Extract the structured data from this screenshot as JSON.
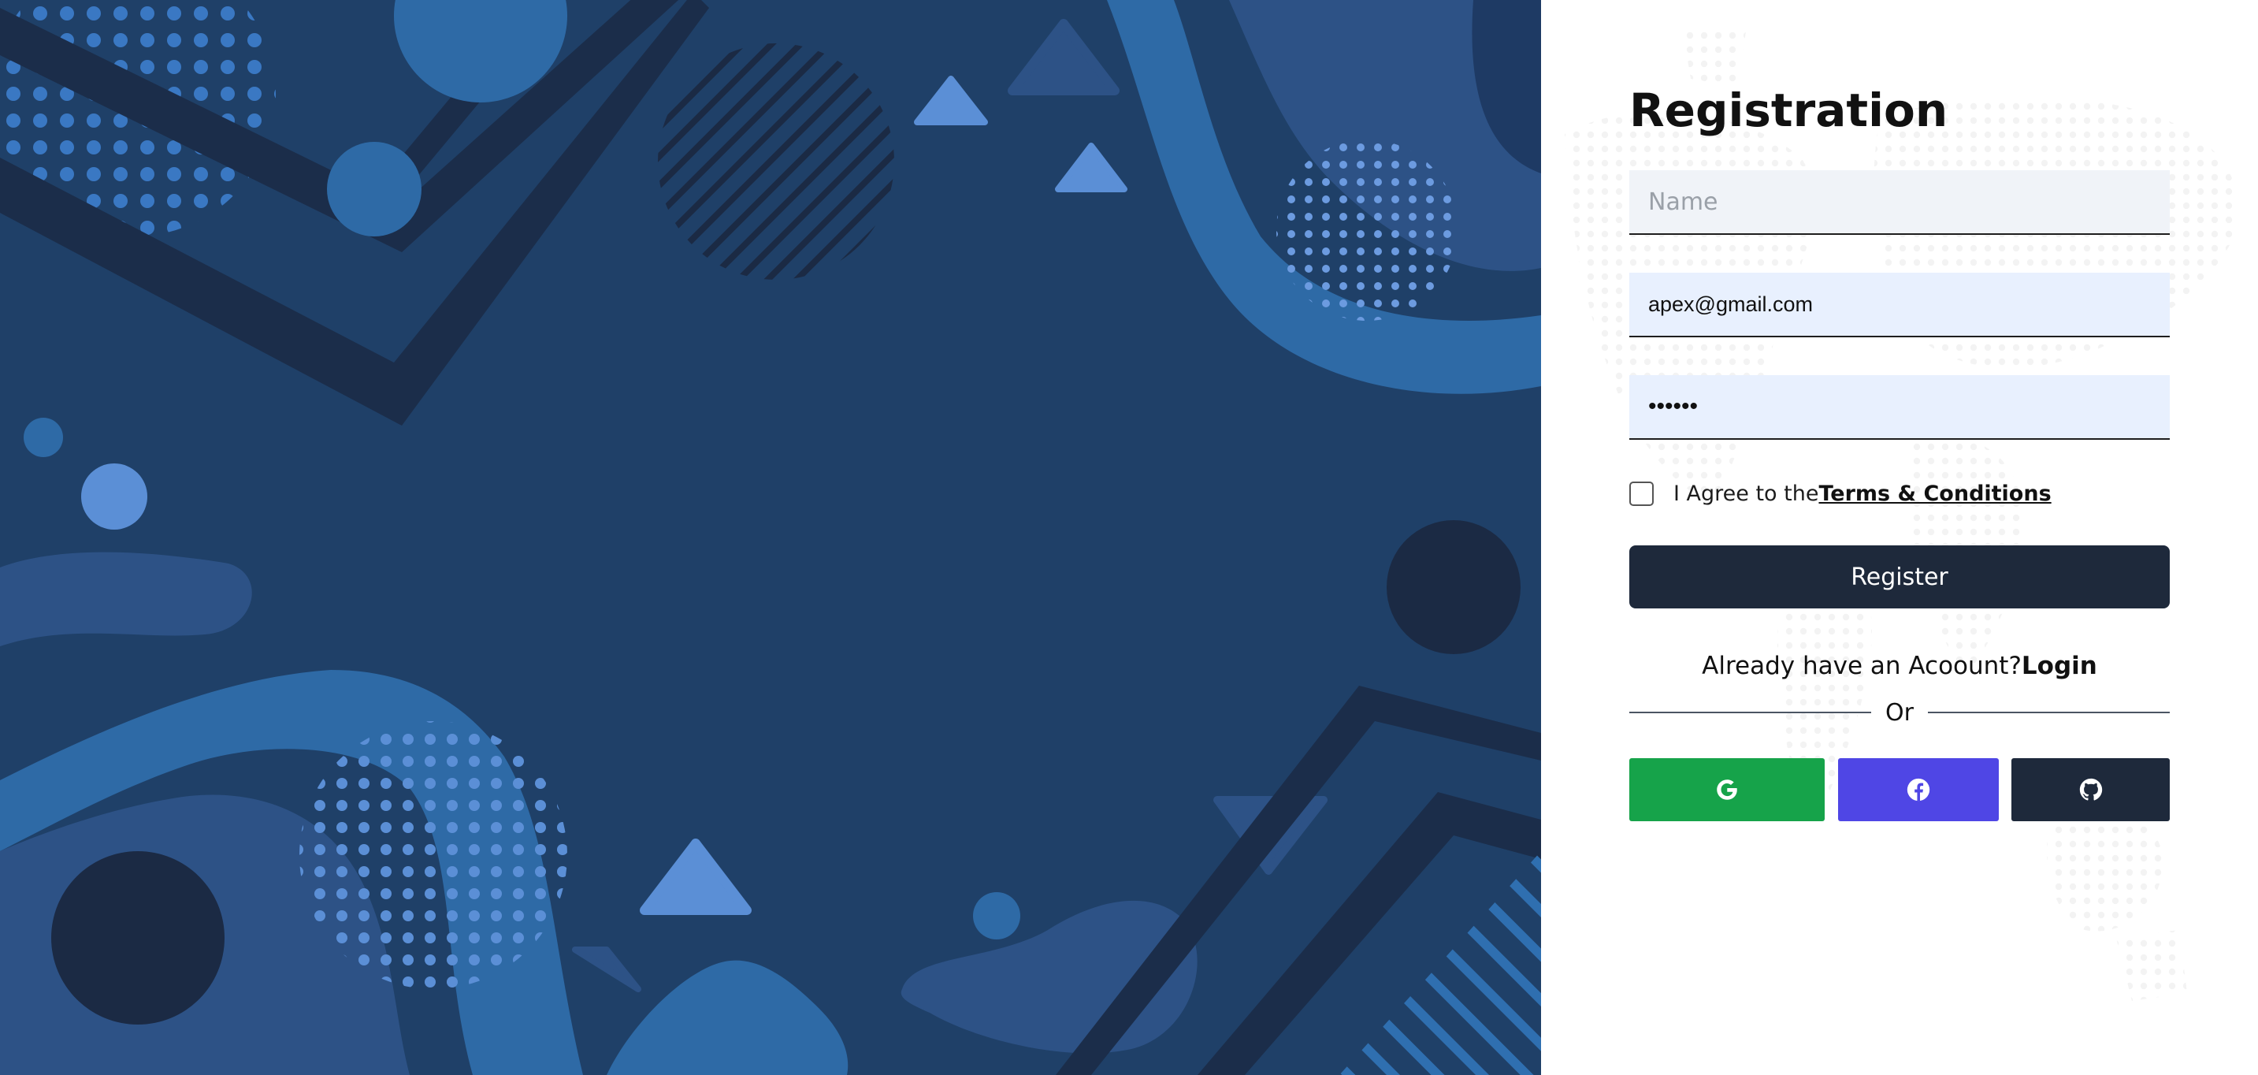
{
  "form": {
    "title": "Registration",
    "name_placeholder": "Name",
    "email_value": "apex@gmail.com",
    "password_value": "••••••",
    "agree_text": "I Agree to the",
    "terms_link": "Terms & Conditions",
    "register_label": "Register",
    "login_prompt": "Already have an Acoount?",
    "login_link": "Login",
    "or_text": "Or"
  },
  "social": {
    "google_icon": "google-icon",
    "facebook_icon": "facebook-icon",
    "github_icon": "github-icon"
  },
  "colors": {
    "art_background": "#1f4068",
    "dark_navy": "#1e293b",
    "google": "#16a34a",
    "facebook": "#4f46e5",
    "github": "#1e293b",
    "email_field_bg": "#e8f0fe"
  }
}
